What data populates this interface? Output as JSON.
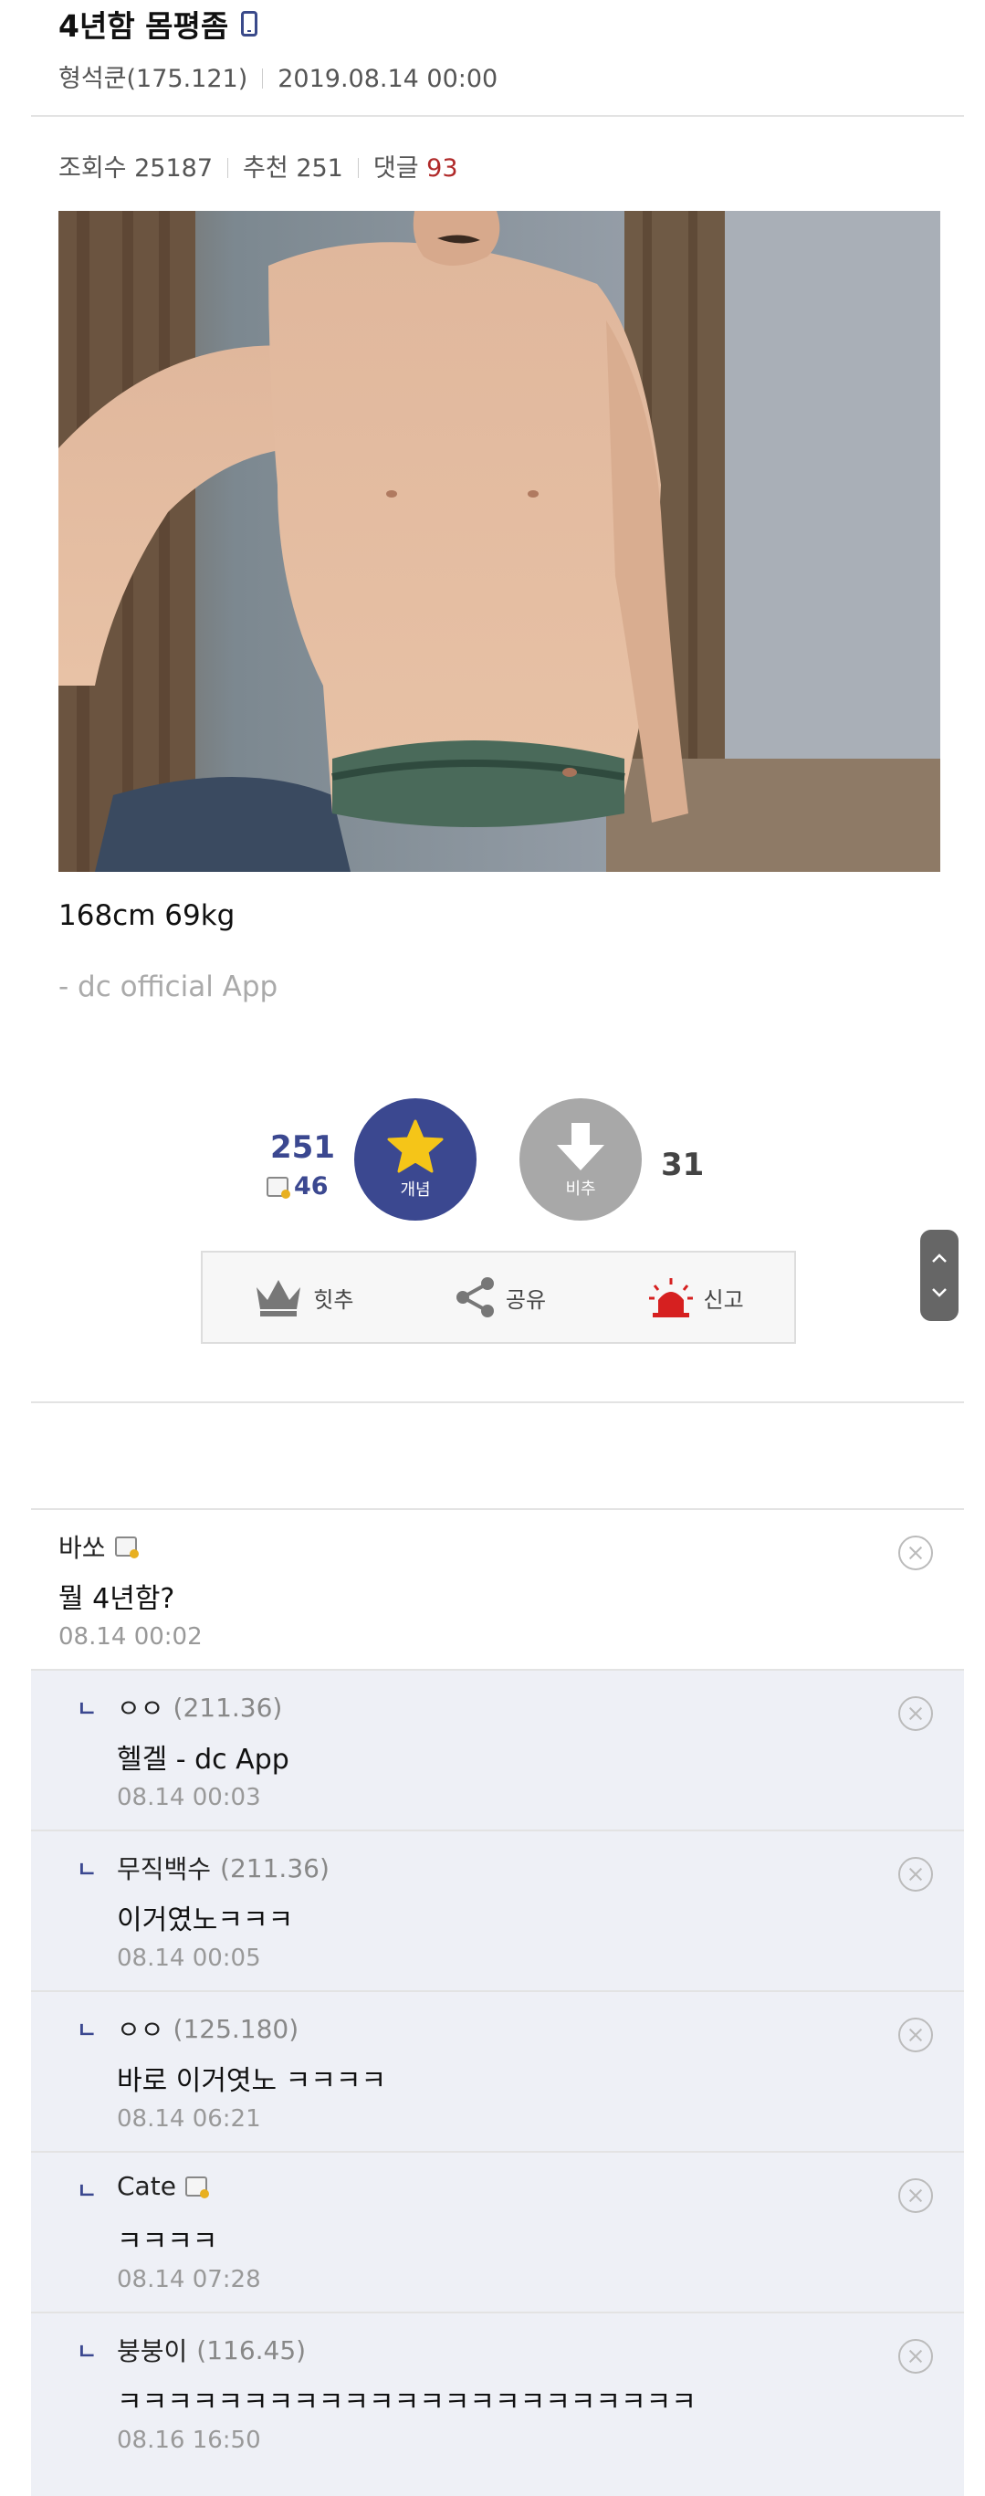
{
  "post": {
    "title": "4년함 몸평좀",
    "author": "형석쿤(175.121)",
    "date": "2019.08.14 00:00",
    "views_label": "조회수",
    "views": "25187",
    "recommend_label": "추천",
    "recommend": "251",
    "comments_label": "댓글",
    "comments": "93",
    "body": "168cm 69kg",
    "signature": "- dc official App"
  },
  "votes": {
    "up_count": "251",
    "fixed_count": "46",
    "up_label": "개념",
    "down_label": "비추",
    "down_count": "31"
  },
  "actions": {
    "hit_label": "힛추",
    "share_label": "공유",
    "report_label": "신고"
  },
  "comments": [
    {
      "nick": "바쏘",
      "ip": "",
      "text": "뭘 4년함?",
      "date": "08.14 00:02",
      "reply": false,
      "badge": true
    },
    {
      "nick": "ㅇㅇ",
      "ip": "(211.36)",
      "text": "헬겔 - dc App",
      "date": "08.14 00:03",
      "reply": true,
      "badge": false
    },
    {
      "nick": "무직백수",
      "ip": "(211.36)",
      "text": "이거였노ㅋㅋㅋ",
      "date": "08.14 00:05",
      "reply": true,
      "badge": false
    },
    {
      "nick": "ㅇㅇ",
      "ip": "(125.180)",
      "text": "바로 이거엿노 ㅋㅋㅋㅋ",
      "date": "08.14 06:21",
      "reply": true,
      "badge": false
    },
    {
      "nick": "Cate",
      "ip": "",
      "text": "ㅋㅋㅋㅋ",
      "date": "08.14 07:28",
      "reply": true,
      "badge": true
    },
    {
      "nick": "붕붕이",
      "ip": "(116.45)",
      "text": "ㅋㅋㅋㅋㅋㅋㅋㅋㅋㅋㅋㅋㅋㅋㅋㅋㅋㅋㅋㅋㅋㅋㅋ",
      "date": "08.16 16:50",
      "reply": true,
      "badge": false
    }
  ],
  "reply_marker": "ㄴ",
  "colors": {
    "accent": "#3b4890",
    "comment_count": "#b02a2a",
    "reply_bg": "#eef0f6"
  }
}
